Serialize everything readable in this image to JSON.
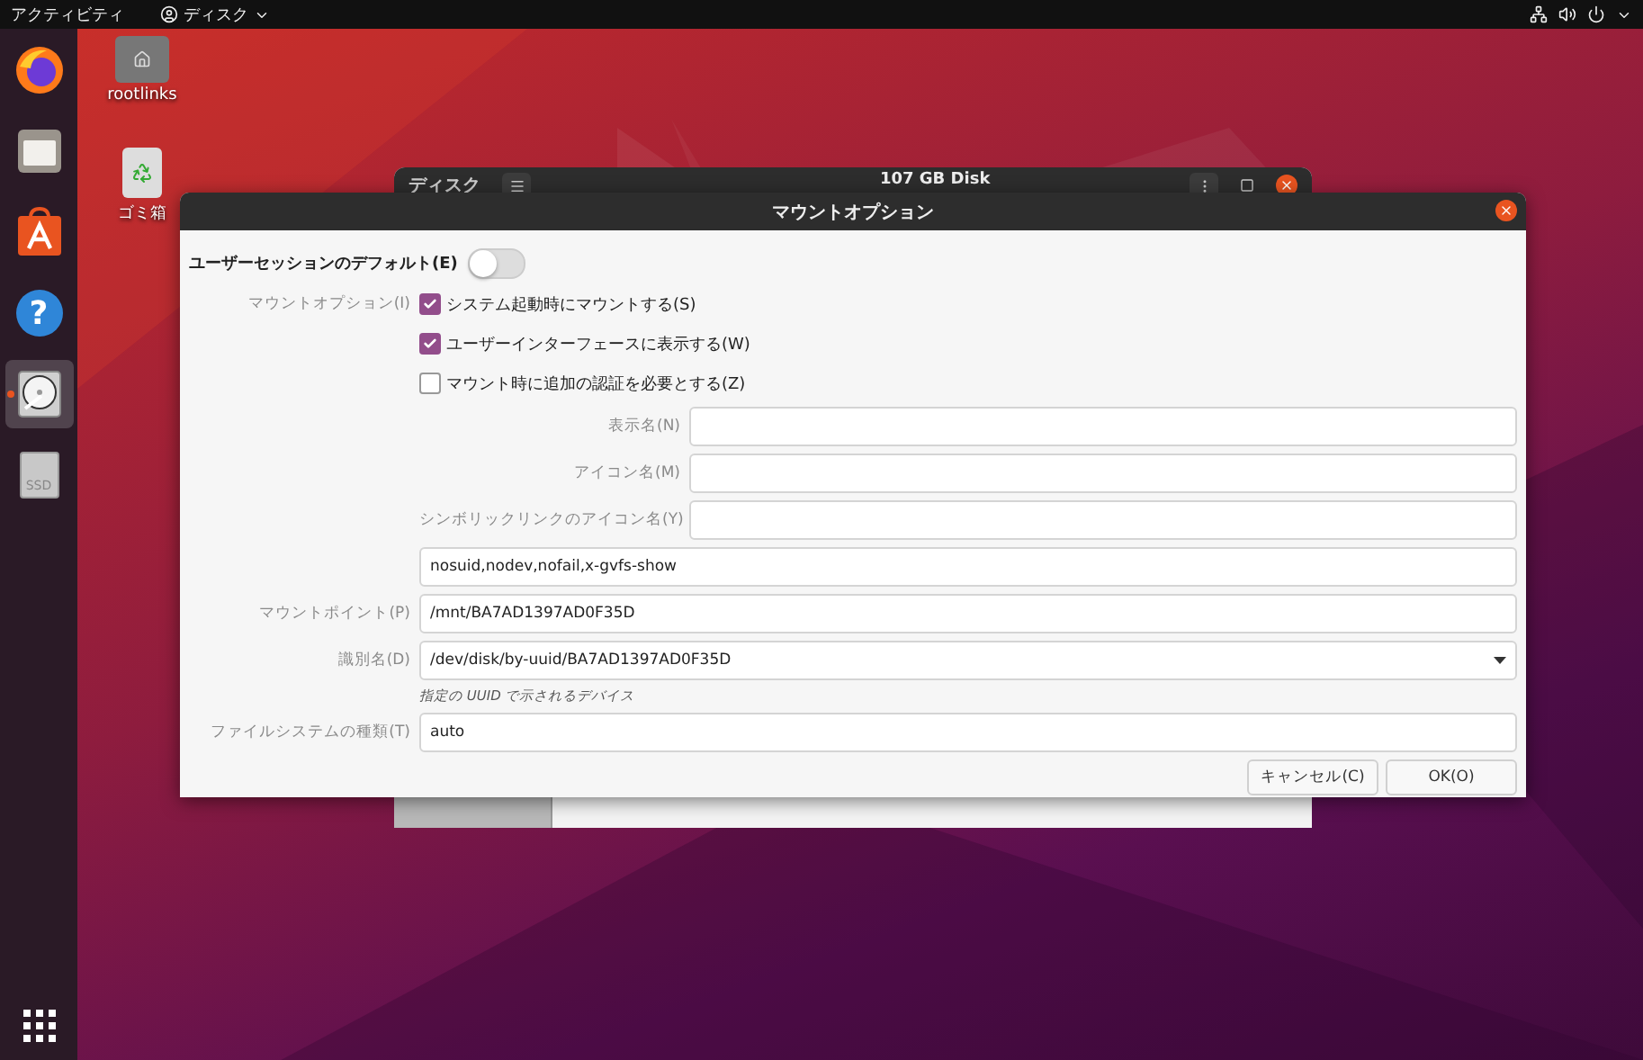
{
  "top_bar": {
    "activities": "アクティビティ",
    "app_menu": "ディスク"
  },
  "dock": {
    "items": [
      {
        "kind": "firefox",
        "selected": false,
        "running": false
      },
      {
        "kind": "files",
        "selected": false,
        "running": false
      },
      {
        "kind": "software",
        "selected": false,
        "running": false
      },
      {
        "kind": "help",
        "selected": false,
        "running": false,
        "glyph": "?"
      },
      {
        "kind": "disk",
        "selected": true,
        "running": true
      },
      {
        "kind": "ssd",
        "selected": false,
        "running": false,
        "glyph": "SSD"
      }
    ]
  },
  "desktop_icons": [
    {
      "kind": "home-folder",
      "label": "rootlinks"
    },
    {
      "kind": "trash",
      "label": "ゴミ箱"
    }
  ],
  "background_window": {
    "header_label": "ディスク",
    "title": "107 GB Disk"
  },
  "dialog": {
    "title": "マウントオプション",
    "user_session_default": {
      "label": "ユーザーセッションのデフォルト(E)",
      "on": false
    },
    "mount_options_label": "マウントオプション(I)",
    "checkboxes": [
      {
        "label": "システム起動時にマウントする(S)",
        "checked": true
      },
      {
        "label": "ユーザーインターフェースに表示する(W)",
        "checked": true
      },
      {
        "label": "マウント時に追加の認証を必要とする(Z)",
        "checked": false
      }
    ],
    "named_fields": [
      {
        "label": "表示名(N)"
      },
      {
        "label": "アイコン名(M)"
      },
      {
        "label": "シンボリックリンクのアイコン名(Y)"
      }
    ],
    "options_value": "nosuid,nodev,nofail,x-gvfs-show",
    "mount_point": {
      "label": "マウントポイント(P)",
      "value": "/mnt/BA7AD1397AD0F35D"
    },
    "identifier": {
      "label": "識別名(D)",
      "value": "/dev/disk/by-uuid/BA7AD1397AD0F35D",
      "hint": "指定の UUID で示されるデバイス"
    },
    "filesystem": {
      "label": "ファイルシステムの種類(T)",
      "value": "auto"
    },
    "buttons": [
      {
        "label": "キャンセル(C)"
      },
      {
        "label": "OK(O)"
      }
    ]
  }
}
